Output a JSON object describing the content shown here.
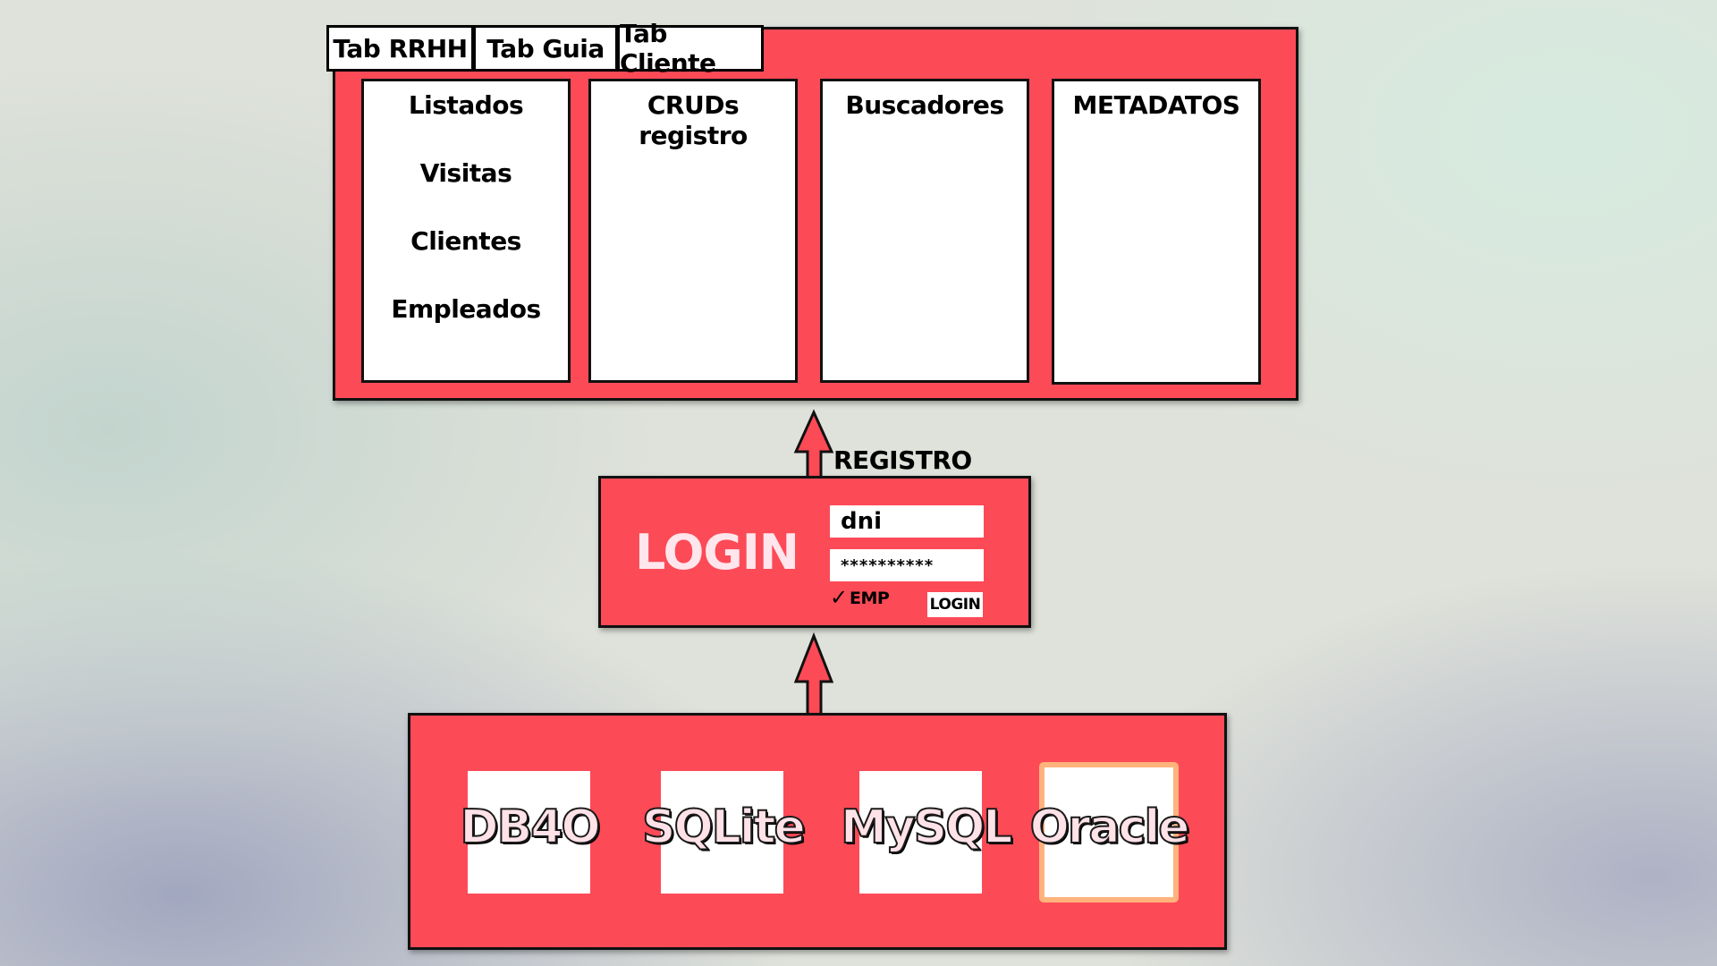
{
  "top_panel": {
    "tabs": [
      "Tab RRHH",
      "Tab Guia",
      "Tab Cliente"
    ],
    "columns": {
      "listados": [
        "Listados",
        "Visitas",
        "Clientes",
        "Empleados"
      ],
      "cruds": [
        "CRUDs",
        "registro"
      ],
      "buscadores": "Buscadores",
      "metadatos": "METADATOS"
    }
  },
  "connector_label": "REGISTRO",
  "login": {
    "title": "LOGIN",
    "dni_value": "dni",
    "password_value": "**********",
    "emp_checked": true,
    "emp_check_glyph": "✓",
    "emp_label": "EMP",
    "button_label": "LOGIN"
  },
  "databases": [
    "DB4O",
    "SQLite",
    "MySQL",
    "Oracle"
  ],
  "selected_database": "Oracle",
  "colors": {
    "panel": "#fd4a57",
    "highlight_border": "#ffb37c",
    "title_text": "#ffe6ec"
  }
}
